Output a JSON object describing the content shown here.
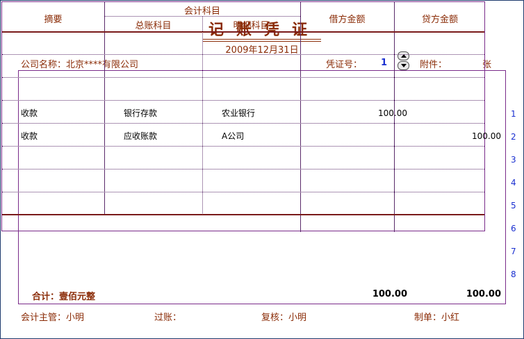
{
  "voucher": {
    "title": "记账凭证",
    "date": "2009年12月31日",
    "company_label": "公司名称：",
    "company_name": "北京****有限公司",
    "voucher_no_label": "凭证号：",
    "voucher_no": "1",
    "attachment_label": "附件：",
    "attachment_unit": "张"
  },
  "table": {
    "headers": {
      "summary": "摘要",
      "account_group": "会计科目",
      "general_account": "总账科目",
      "detail_account": "明细科目",
      "debit": "借方金额",
      "credit": "贷方金额"
    },
    "rows": [
      {
        "no": "1",
        "summary": "收款",
        "general": "银行存款",
        "detail": "农业银行",
        "debit": "100.00",
        "credit": ""
      },
      {
        "no": "2",
        "summary": "收款",
        "general": "应收账款",
        "detail": "A公司",
        "debit": "",
        "credit": "100.00"
      },
      {
        "no": "3",
        "summary": "",
        "general": "",
        "detail": "",
        "debit": "",
        "credit": ""
      },
      {
        "no": "4",
        "summary": "",
        "general": "",
        "detail": "",
        "debit": "",
        "credit": ""
      },
      {
        "no": "5",
        "summary": "",
        "general": "",
        "detail": "",
        "debit": "",
        "credit": ""
      },
      {
        "no": "6",
        "summary": "",
        "general": "",
        "detail": "",
        "debit": "",
        "credit": ""
      },
      {
        "no": "7",
        "summary": "",
        "general": "",
        "detail": "",
        "debit": "",
        "credit": ""
      },
      {
        "no": "8",
        "summary": "",
        "general": "",
        "detail": "",
        "debit": "",
        "credit": ""
      }
    ],
    "total": {
      "label": "合计：壹佰元整",
      "debit": "100.00",
      "credit": "100.00"
    }
  },
  "footer": {
    "supervisor_label": "会计主管：",
    "supervisor": "小明",
    "posting_label": "过账：",
    "posting": "",
    "review_label": "复核：",
    "reviewer": "小明",
    "maker_label": "制单：",
    "maker": "小红"
  },
  "colors": {
    "label": "#8a2b06",
    "grid": "#7a2b8a",
    "number": "#1a2fd0"
  },
  "icons": [
    "spin-up-icon",
    "spin-down-icon"
  ]
}
